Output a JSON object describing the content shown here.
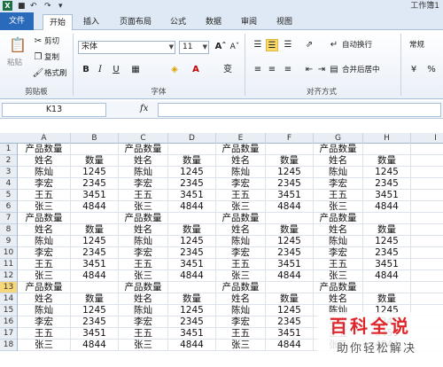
{
  "title_bar": {
    "title": "工作簿1",
    "app_icon": "X"
  },
  "ribbon_tabs": [
    "文件",
    "开始",
    "插入",
    "页面布局",
    "公式",
    "数据",
    "审阅",
    "视图"
  ],
  "clipboard": {
    "paste": "粘贴",
    "cut": "剪切",
    "copy": "复制",
    "format_painter": "格式刷",
    "label": "剪贴板"
  },
  "font": {
    "name": "宋体",
    "size": "11",
    "label": "字体",
    "bold": "B",
    "italic": "I",
    "underline": "U"
  },
  "alignment": {
    "wrap": "自动换行",
    "merge": "合并后居中",
    "label": "对齐方式"
  },
  "number": {
    "format": "常规"
  },
  "formula_bar": {
    "name_box": "K13",
    "fx": "fx",
    "formula": ""
  },
  "columns": [
    "A",
    "B",
    "C",
    "D",
    "E",
    "F",
    "G",
    "H",
    "I"
  ],
  "rows": [
    [
      "产品数量",
      "",
      "产品数量",
      "",
      "产品数量",
      "",
      "产品数量",
      "",
      ""
    ],
    [
      "姓名",
      "数量",
      "姓名",
      "数量",
      "姓名",
      "数量",
      "姓名",
      "数量",
      ""
    ],
    [
      "陈灿",
      "1245",
      "陈灿",
      "1245",
      "陈灿",
      "1245",
      "陈灿",
      "1245",
      ""
    ],
    [
      "李宏",
      "2345",
      "李宏",
      "2345",
      "李宏",
      "2345",
      "李宏",
      "2345",
      ""
    ],
    [
      "王五",
      "3451",
      "王五",
      "3451",
      "王五",
      "3451",
      "王五",
      "3451",
      ""
    ],
    [
      "张三",
      "4844",
      "张三",
      "4844",
      "张三",
      "4844",
      "张三",
      "4844",
      ""
    ],
    [
      "产品数量",
      "",
      "产品数量",
      "",
      "产品数量",
      "",
      "产品数量",
      "",
      ""
    ],
    [
      "姓名",
      "数量",
      "姓名",
      "数量",
      "姓名",
      "数量",
      "姓名",
      "数量",
      ""
    ],
    [
      "陈灿",
      "1245",
      "陈灿",
      "1245",
      "陈灿",
      "1245",
      "陈灿",
      "1245",
      ""
    ],
    [
      "李宏",
      "2345",
      "李宏",
      "2345",
      "李宏",
      "2345",
      "李宏",
      "2345",
      ""
    ],
    [
      "王五",
      "3451",
      "王五",
      "3451",
      "王五",
      "3451",
      "王五",
      "3451",
      ""
    ],
    [
      "张三",
      "4844",
      "张三",
      "4844",
      "张三",
      "4844",
      "张三",
      "4844",
      ""
    ],
    [
      "产品数量",
      "",
      "产品数量",
      "",
      "产品数量",
      "",
      "产品数量",
      "",
      ""
    ],
    [
      "姓名",
      "数量",
      "姓名",
      "数量",
      "姓名",
      "数量",
      "姓名",
      "数量",
      ""
    ],
    [
      "陈灿",
      "1245",
      "陈灿",
      "1245",
      "陈灿",
      "1245",
      "陈灿",
      "1245",
      ""
    ],
    [
      "李宏",
      "2345",
      "李宏",
      "2345",
      "李宏",
      "2345",
      "李宏",
      "2345",
      ""
    ],
    [
      "王五",
      "3451",
      "王五",
      "3451",
      "王五",
      "3451",
      "王五",
      "3451",
      ""
    ],
    [
      "张三",
      "4844",
      "张三",
      "4844",
      "张三",
      "4844",
      "张三",
      "4844",
      ""
    ]
  ],
  "watermark": {
    "logo": "百科全说",
    "sub": "助你轻松解决"
  },
  "colors": {
    "file_tab": "#2a6aba",
    "watermark_red": "#e0262a"
  }
}
